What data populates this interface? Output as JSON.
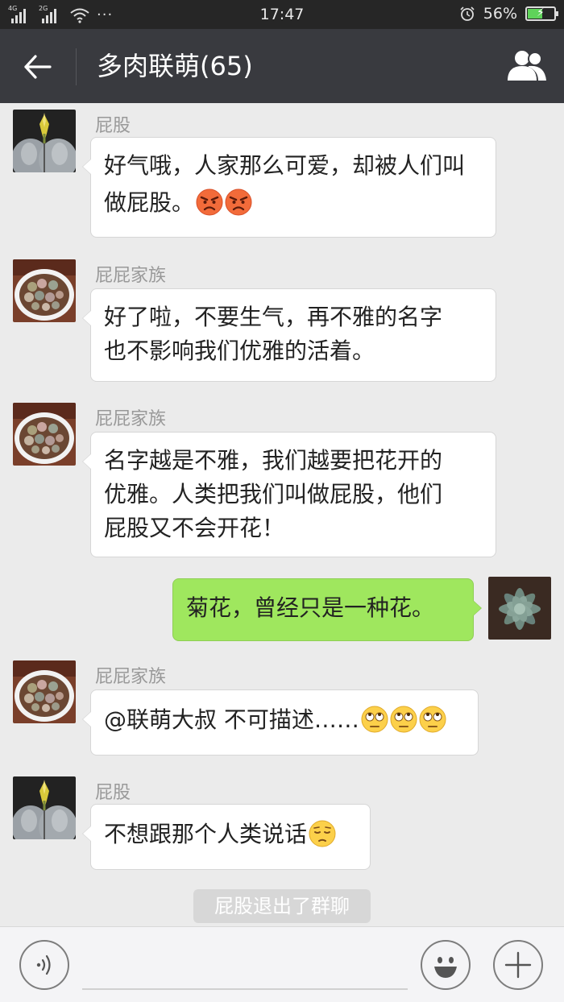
{
  "status_bar": {
    "network_1": "4G",
    "network_2": "2G",
    "time": "17:47",
    "battery": "56%",
    "battery_level": 0.56
  },
  "header": {
    "title": "多肉联萌(65)"
  },
  "messages": [
    {
      "sender": "屁股",
      "side": "left",
      "avatar": "icon-plant-avatar",
      "text": "好气哦，人家那么可爱，却被人们叫做屁股。",
      "emoji": [
        "angry-face",
        "angry-face"
      ]
    },
    {
      "sender": "屁屁家族",
      "side": "left",
      "avatar": "lithops-pot-avatar",
      "text_lines": [
        "好了啦，不要生气，再不雅的名字",
        "也不影响我们优雅的活着。"
      ]
    },
    {
      "sender": "屁屁家族",
      "side": "left",
      "avatar": "lithops-pot-avatar",
      "text_lines": [
        "名字越是不雅，我们越要把花开的",
        "优雅。人类把我们叫做屁股，他们",
        "屁股又不会开花！"
      ]
    },
    {
      "sender": "",
      "side": "right",
      "avatar": "echeveria-avatar",
      "text": "菊花，曾经只是一种花。"
    },
    {
      "sender": "屁屁家族",
      "side": "left",
      "avatar": "lithops-pot-avatar",
      "text": "@联萌大叔 不可描述……",
      "emoji": [
        "eye-roll-face",
        "eye-roll-face",
        "eye-roll-face"
      ]
    },
    {
      "sender": "屁股",
      "side": "left",
      "avatar": "icon-plant-avatar",
      "text": "不想跟那个人类说话",
      "emoji": [
        "pensive-face"
      ]
    }
  ],
  "system_message": "屁股退出了群聊",
  "input_bar": {
    "voice_icon": "voice-icon",
    "emoji_icon": "smiley-icon",
    "more_icon": "plus-icon"
  },
  "colors": {
    "header_bg": "#393a3f",
    "status_bg": "#262626",
    "chat_bg": "#ebebeb",
    "my_bubble": "#9fe75e"
  }
}
